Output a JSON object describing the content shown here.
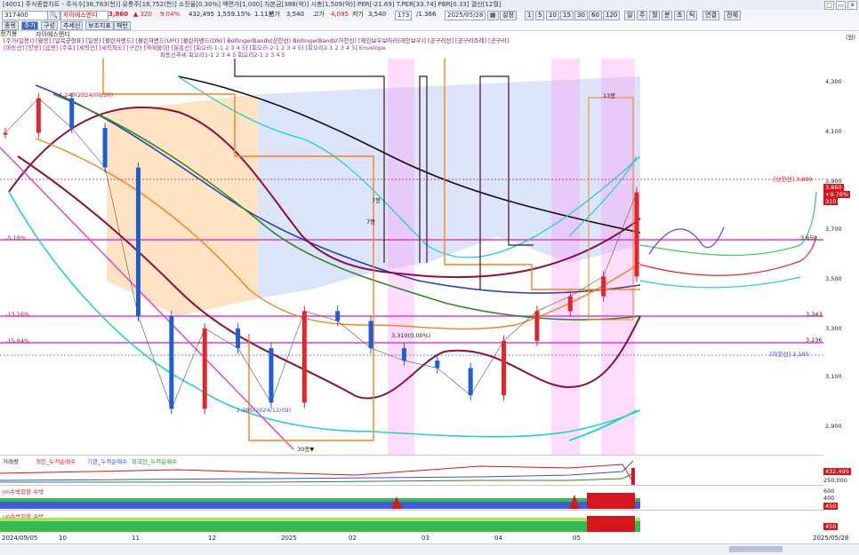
{
  "title_bar": {
    "text": "[4001] 주식종합차트 - 주식수[38,783(천)] 유통주[18,752(천)] 소진율[0.30%] 액면가[1,000] 자본금[388(억)] 시총[1,509(억)] PER[-21.69] T.PER[33.74] PBR[0.33] 결산[12월]"
  },
  "window_buttons": [
    "□",
    "▭",
    "✕"
  ],
  "toolbar": {
    "code_value": "317400",
    "stock_name": "자이에스앤디",
    "price": "3,860",
    "change": "▲ 320",
    "change_pct": "9.04%",
    "volume": "432,495",
    "vol_pct": "1,559.15%",
    "time_period": "1.11분",
    "open_label": "시가",
    "open_val": "3,540",
    "high_label": "고가",
    "high_val": "4,095",
    "low_label": "저가",
    "low_val": "3,540",
    "count_val": "173",
    "ratio_val": "/1.366",
    "date_val": "2025/05/28",
    "setting_label": "설정",
    "period_buttons": [
      "1",
      "5",
      "10",
      "15",
      "30",
      "60",
      "120"
    ],
    "type_buttons": [
      "일",
      "주",
      "월",
      "분",
      "초",
      "틱"
    ],
    "view_buttons": [
      "연결",
      "전체"
    ]
  },
  "toolbar2": {
    "tabs": [
      "종목",
      "주가",
      "구성",
      "추세선",
      "보조지표",
      "패턴"
    ]
  },
  "left_label": "정기용",
  "chart_title": "자이에스앤디",
  "indicator_legend_1": "[주가(일봉)]  [월봉]  [일목균형표]  [일봉]  [볼린저밴드]  [볼린저밴드(UP)]  [볼린저밴드(DN)]  BollingerBands(상한선)  BollingerBands(하한선)  [제인보우보자리(레인보우)]  [공구리선]  [공구리조례]  [공구리]",
  "indicator_legend_2": "[파동선]  [양봉]  [음봉]  [주포]  [세력선]  [세력파도]  [구간]  [역매물대]  [분홍선]  [회오리-1-1 2 3 4 5]  [회오리-2-1 2 3 4 5]  [회오리2-1 2 3 4 5]  Envelope",
  "indicator_legend_3": "파동선추세  회오리1-1 2 3 4 5  회오리2-1 2 3 4 5",
  "right_axis": {
    "unit_label": "(원)",
    "ticks": [
      "4,300",
      "4,100",
      "3,900",
      "3,700",
      "3,500",
      "3,300",
      "3,100",
      "2,900"
    ]
  },
  "price_lines": {
    "upper_limit": "[상한선] 3,899",
    "lower_limit": "[하한선] 3,185",
    "line_3650": "3,650",
    "line_3343": "3,343",
    "line_3236": "3,236",
    "last_price_tag": "3,860",
    "last_change_tag": "+9.76%",
    "last_vol_tag": "310"
  },
  "left_pct_labels": {
    "pct_a": "-5.19%",
    "pct_b": "-13.16%",
    "pct_c": "-15.84%"
  },
  "annotations": {
    "high_label": "4,240(2024/09/20)",
    "low_label": "2,985(2024/12/09)",
    "mid_label": "3,310(0.00%)",
    "box_label_1": "7봉",
    "box_label_2": "7봉",
    "box_label_3": "13봉",
    "bottom_marker": "30봉▼"
  },
  "volume_panel": {
    "legend_items": [
      "거래량",
      "개인_누적순매수",
      "기관_누적순매수",
      "외국인_누적순매수"
    ],
    "right_val_1": "432,495",
    "right_val_2": "250,000"
  },
  "rsi_panel_1": {
    "legend": "on수박겉할 수박",
    "right_val": "450",
    "right_val_2": "600",
    "right_val_3": "400"
  },
  "rsi_panel_2": {
    "legend": "up수박겉할 수박",
    "right_val": "450"
  },
  "x_axis": {
    "labels": [
      {
        "text": "2024/09/05",
        "kind": "start"
      },
      {
        "text": "10",
        "kind": "month"
      },
      {
        "text": "11",
        "kind": "month"
      },
      {
        "text": "12",
        "kind": "month"
      },
      {
        "text": "2025",
        "kind": "year"
      },
      {
        "text": "02",
        "kind": "month"
      },
      {
        "text": "03",
        "kind": "month"
      },
      {
        "text": "04",
        "kind": "month"
      },
      {
        "text": "05",
        "kind": "month"
      },
      {
        "text": "2025/05/28",
        "kind": "end"
      }
    ]
  },
  "colors": {
    "up_candle": "#e0262b",
    "down_candle": "#1f5ed0",
    "ichimoku_cloud": "#c9d5f7",
    "orange_band": "#ffcf9a",
    "pink_band": "#ff8cf0",
    "magenta_line": "#e43ad6",
    "accent_title": "#d6161d"
  },
  "chart_data": {
    "type": "line",
    "title": "",
    "xlabel": "",
    "ylabel": "",
    "ylim": [
      2800,
      4400
    ],
    "x": [
      "2024-09-05",
      "2024-09-20",
      "2024-10-10",
      "2024-11-01",
      "2024-11-20",
      "2024-12-09",
      "2024-12-30",
      "2025-01-20",
      "2025-02-03",
      "2025-02-10",
      "2025-02-20",
      "2025-03-05",
      "2025-03-20",
      "2025-04-01",
      "2025-04-09",
      "2025-04-20",
      "2025-05-01",
      "2025-05-10",
      "2025-05-20",
      "2025-05-28"
    ],
    "series": [
      {
        "values": [
          4100,
          4240,
          4120,
          3960,
          3360,
          2985,
          3310,
          3230,
          3010,
          3380,
          3340,
          3230,
          3180,
          3150,
          3040,
          3260,
          3380,
          3440,
          3520,
          3860
        ]
      }
    ]
  }
}
